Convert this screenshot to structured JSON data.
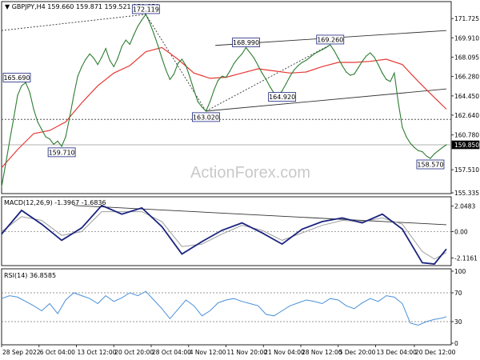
{
  "chart_data": [
    {
      "type": "line",
      "panel": "price",
      "header": "▼ GBPJPY,H4  159.660 159.871 159.521 159.850",
      "symbol": "GBPJPY",
      "timeframe": "H4",
      "ohlc": {
        "open": 159.66,
        "high": 159.871,
        "low": 159.521,
        "close": 159.85
      },
      "ylim": [
        155.335,
        173.245
      ],
      "y_ticks": [
        "171.725",
        "169.910",
        "168.095",
        "166.280",
        "164.450",
        "162.640",
        "160.780",
        "159.850",
        "157.510",
        "155.335"
      ],
      "x_ticks": [
        "28 Sep 2022",
        "6 Oct 04:00",
        "13 Oct 12:00",
        "20 Oct 20:00",
        "28 Oct 04:00",
        "4 Nov 12:00",
        "11 Nov 20:00",
        "21 Nov 04:00",
        "28 Nov 12:00",
        "5 Dec 20:00",
        "13 Dec 04:00",
        "20 Dec 12:00"
      ],
      "series": [
        {
          "name": "GBPJPY",
          "color": "#2e7d32",
          "x": [
            0,
            3,
            6,
            9,
            12,
            15,
            18,
            21,
            24,
            27,
            30,
            33,
            36,
            39,
            42,
            45,
            48,
            51,
            54,
            57,
            60,
            63,
            66,
            69,
            72,
            75,
            78,
            81,
            84,
            87,
            90,
            93,
            96,
            99,
            102,
            105,
            108,
            111,
            114,
            117,
            120,
            123,
            126,
            129,
            132,
            135,
            138,
            141,
            144,
            147,
            150,
            153,
            156,
            159,
            162,
            165,
            168,
            171,
            174,
            177,
            180,
            183,
            186,
            189,
            192,
            195,
            198,
            201,
            204,
            207,
            210,
            213,
            216,
            219,
            222,
            225,
            228,
            231,
            234,
            237,
            240,
            243,
            246,
            249,
            252,
            255,
            258,
            261,
            264,
            267,
            270,
            273,
            276,
            279,
            282,
            285,
            288,
            291,
            294,
            297,
            300,
            303,
            306,
            309,
            312,
            315,
            318,
            321,
            324,
            327,
            330,
            333
          ],
          "values": [
            155.9,
            158.0,
            160.2,
            162.3,
            164.5,
            165.4,
            165.7,
            164.8,
            163.2,
            162.0,
            161.3,
            160.6,
            160.4,
            159.9,
            160.2,
            159.71,
            160.6,
            162.5,
            164.5,
            166.3,
            167.2,
            167.9,
            168.4,
            168.0,
            167.4,
            168.1,
            168.9,
            167.8,
            167.2,
            168.0,
            169.1,
            169.7,
            169.3,
            170.2,
            171.0,
            171.6,
            172.119,
            171.3,
            170.3,
            169.2,
            168.0,
            166.9,
            166.0,
            166.5,
            167.5,
            167.9,
            167.3,
            166.2,
            165.0,
            163.9,
            163.4,
            163.02,
            163.9,
            165.0,
            165.9,
            166.3,
            166.2,
            166.8,
            167.5,
            168.0,
            168.4,
            168.99,
            168.5,
            168.0,
            167.3,
            166.6,
            166.0,
            165.3,
            164.7,
            164.4,
            164.92,
            165.6,
            166.3,
            166.9,
            167.3,
            167.6,
            167.8,
            168.1,
            168.4,
            168.6,
            168.8,
            169.0,
            169.26,
            168.7,
            168.0,
            167.3,
            166.7,
            166.4,
            166.5,
            167.1,
            167.7,
            168.2,
            168.5,
            168.1,
            167.4,
            166.6,
            166.0,
            165.8,
            166.6,
            163.8,
            161.5,
            160.6,
            160.0,
            159.6,
            159.3,
            159.2,
            158.8,
            158.57,
            159.0,
            159.3,
            159.6,
            159.85
          ]
        },
        {
          "name": "SMA",
          "color": "#e53935",
          "x": [
            0,
            12,
            24,
            36,
            48,
            60,
            72,
            84,
            96,
            108,
            120,
            132,
            144,
            156,
            168,
            180,
            192,
            204,
            216,
            228,
            240,
            252,
            264,
            276,
            288,
            300,
            312,
            324,
            333
          ],
          "values": [
            157.7,
            159.4,
            160.9,
            161.2,
            162.0,
            163.8,
            165.4,
            166.6,
            167.3,
            168.6,
            169.0,
            167.9,
            166.6,
            166.1,
            166.2,
            166.6,
            167.0,
            166.8,
            166.6,
            166.7,
            167.2,
            167.6,
            167.6,
            167.7,
            167.9,
            167.4,
            165.8,
            164.3,
            163.2
          ]
        }
      ],
      "swing_labels": [
        {
          "text": "172.119",
          "x": 108,
          "y": 172.119
        },
        {
          "text": "165.690",
          "x": 6,
          "y": 165.69
        },
        {
          "text": "159.710",
          "x": 45,
          "y": 159.71
        },
        {
          "text": "163.020",
          "x": 153,
          "y": 163.02
        },
        {
          "text": "168.990",
          "x": 183,
          "y": 168.99
        },
        {
          "text": "164.920",
          "x": 210,
          "y": 164.92
        },
        {
          "text": "169.260",
          "x": 246,
          "y": 169.26
        },
        {
          "text": "158.570",
          "x": 321,
          "y": 158.57
        }
      ],
      "levels": [
        {
          "value": 162.24,
          "label": "162.240",
          "style": "dotted"
        },
        {
          "value": 159.85,
          "label": "159.850",
          "style": "current"
        }
      ],
      "trendlines": [
        {
          "points": [
            [
              0,
              170.6
            ],
            [
              108,
              172.119
            ]
          ],
          "style": "dotted"
        },
        {
          "points": [
            [
              108,
              172.119
            ],
            [
              153,
              163.02
            ]
          ],
          "style": "dotted"
        },
        {
          "points": [
            [
              153,
              163.02
            ],
            [
              246,
              169.26
            ]
          ],
          "style": "dotted"
        },
        {
          "points": [
            [
              153,
              163.02
            ],
            [
              333,
              165.1
            ]
          ],
          "style": "solid"
        },
        {
          "points": [
            [
              160,
              169.2
            ],
            [
              333,
              170.6
            ]
          ],
          "style": "solid"
        }
      ],
      "watermark": "ActionForex.com"
    },
    {
      "type": "line",
      "panel": "macd",
      "header": "MACD(12,26,9) -1.3967 -1.6836",
      "ylim": [
        -2.6,
        2.6
      ],
      "y_ticks": [
        "2.0483",
        "0.00",
        "-2.1161"
      ],
      "series": [
        {
          "name": "MACD",
          "color": "#1a237e",
          "x": [
            0,
            15,
            30,
            45,
            60,
            75,
            90,
            105,
            120,
            135,
            150,
            165,
            180,
            195,
            210,
            225,
            240,
            255,
            270,
            285,
            300,
            315,
            324,
            333
          ],
          "values": [
            -0.2,
            1.7,
            0.6,
            -0.7,
            0.3,
            2.1,
            1.4,
            1.9,
            0.4,
            -1.8,
            -0.8,
            0.1,
            0.7,
            -0.1,
            -1.0,
            0.2,
            0.8,
            1.1,
            0.7,
            1.4,
            0.2,
            -2.5,
            -2.6,
            -1.3967
          ]
        },
        {
          "name": "Signal",
          "color": "#9e9e9e",
          "x": [
            0,
            15,
            30,
            45,
            60,
            75,
            90,
            105,
            120,
            135,
            150,
            165,
            180,
            195,
            210,
            225,
            240,
            255,
            270,
            285,
            300,
            315,
            324,
            333
          ],
          "values": [
            0.0,
            1.2,
            0.9,
            -0.3,
            0.0,
            1.6,
            1.6,
            1.6,
            0.8,
            -1.2,
            -1.0,
            -0.2,
            0.5,
            0.1,
            -0.7,
            -0.1,
            0.5,
            0.9,
            0.8,
            1.1,
            0.6,
            -1.6,
            -2.2,
            -1.6836
          ]
        }
      ],
      "trendline": {
        "points": [
          [
            54,
            2.1
          ],
          [
            333,
            0.55
          ]
        ]
      }
    },
    {
      "type": "line",
      "panel": "rsi",
      "header": "RSI(14) 36.8585",
      "ylim": [
        0,
        100
      ],
      "y_ticks": [
        "100",
        "70",
        "30",
        "0"
      ],
      "series": [
        {
          "name": "RSI(14)",
          "color": "#4a90d9",
          "x": [
            0,
            6,
            12,
            18,
            24,
            30,
            36,
            42,
            48,
            54,
            60,
            66,
            72,
            78,
            84,
            90,
            96,
            102,
            108,
            114,
            120,
            126,
            132,
            138,
            144,
            150,
            156,
            162,
            168,
            174,
            180,
            186,
            192,
            198,
            204,
            210,
            216,
            222,
            228,
            234,
            240,
            246,
            252,
            258,
            264,
            270,
            276,
            282,
            288,
            294,
            300,
            306,
            312,
            318,
            324,
            330,
            333
          ],
          "values": [
            62,
            66,
            64,
            58,
            52,
            45,
            55,
            41,
            60,
            70,
            66,
            62,
            55,
            66,
            58,
            63,
            70,
            66,
            72,
            60,
            48,
            34,
            47,
            60,
            52,
            38,
            45,
            56,
            60,
            62,
            58,
            55,
            52,
            40,
            38,
            45,
            52,
            56,
            60,
            58,
            55,
            62,
            60,
            52,
            48,
            56,
            62,
            58,
            66,
            64,
            55,
            28,
            25,
            30,
            33,
            35,
            36.8585
          ]
        }
      ]
    }
  ],
  "x_tick_positions": [
    0,
    28,
    56,
    84,
    112,
    140,
    168,
    196,
    224,
    252,
    280,
    309
  ],
  "colors": {
    "price": "#2e7d32",
    "ma": "#e53935",
    "macd": "#1a237e",
    "signal": "#9e9e9e",
    "rsi": "#4a90d9",
    "label_border": "#1a237e",
    "grid": "#555555"
  }
}
